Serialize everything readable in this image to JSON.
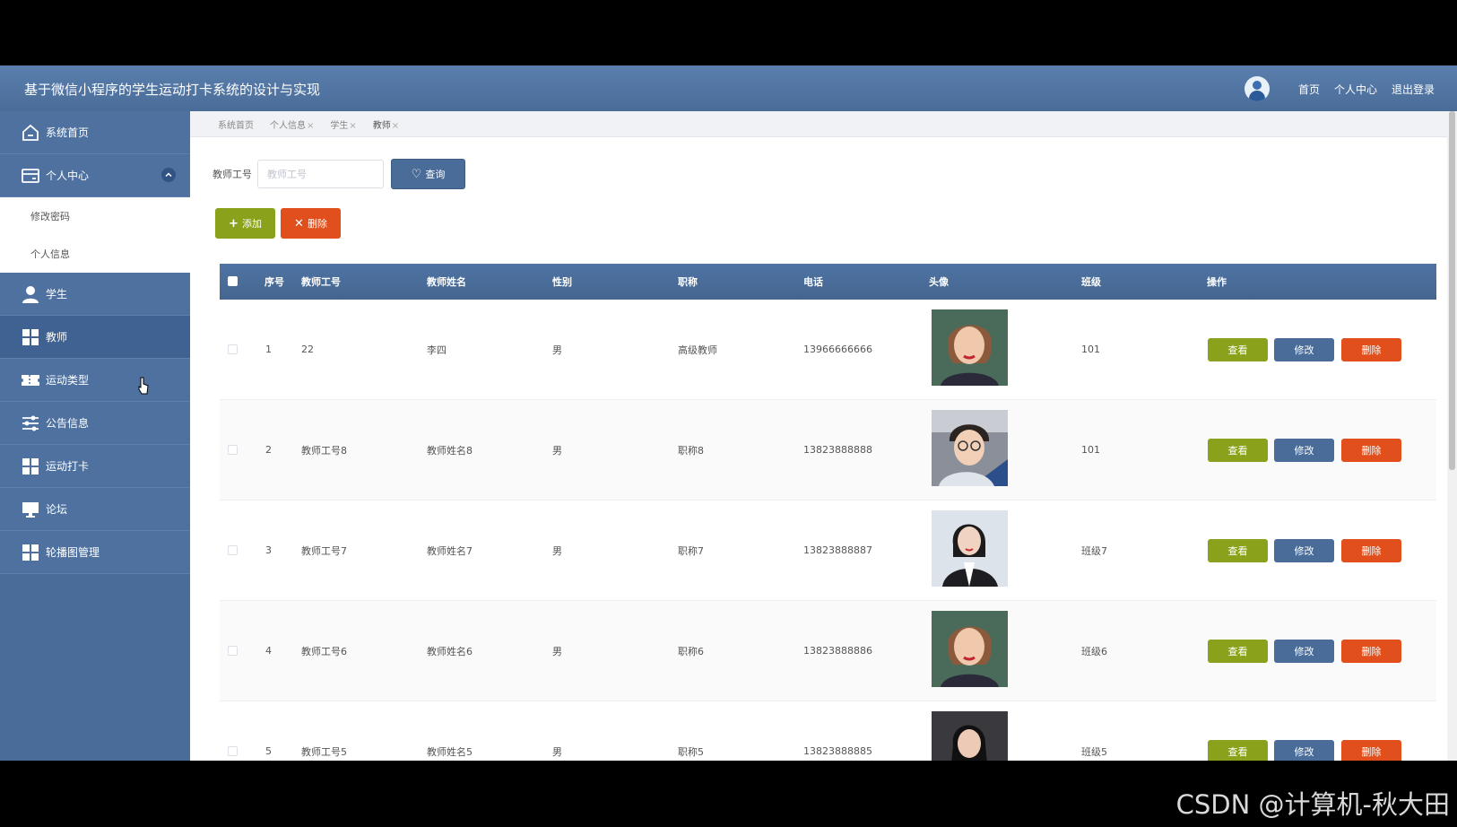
{
  "header": {
    "title": "基于微信小程序的学生运动打卡系统的设计与实现",
    "links": [
      "首页",
      "个人中心",
      "退出登录"
    ]
  },
  "sidebar": {
    "items": [
      {
        "label": "系统首页",
        "icon": "home-icon"
      },
      {
        "label": "个人中心",
        "icon": "card-icon"
      },
      {
        "label": "学生",
        "icon": "user-icon"
      },
      {
        "label": "教师",
        "icon": "grid-icon"
      },
      {
        "label": "运动类型",
        "icon": "ticket-icon"
      },
      {
        "label": "公告信息",
        "icon": "sliders-icon"
      },
      {
        "label": "运动打卡",
        "icon": "grid-icon"
      },
      {
        "label": "论坛",
        "icon": "monitor-icon"
      },
      {
        "label": "轮播图管理",
        "icon": "grid-icon"
      }
    ],
    "submenu": [
      "修改密码",
      "个人信息"
    ]
  },
  "tabs": [
    {
      "label": "系统首页"
    },
    {
      "label": "个人信息",
      "closable": true
    },
    {
      "label": "学生",
      "closable": true
    },
    {
      "label": "教师",
      "closable": true
    }
  ],
  "search": {
    "label": "教师工号",
    "placeholder": "教师工号",
    "query_label": "查询"
  },
  "actions": {
    "add_label": "添加",
    "delete_label": "删除"
  },
  "table": {
    "columns": [
      "序号",
      "教师工号",
      "教师姓名",
      "性别",
      "职称",
      "电话",
      "头像",
      "班级",
      "操作"
    ],
    "rows": [
      {
        "no": "1",
        "id": "22",
        "name": "李四",
        "gender": "男",
        "title": "高级教师",
        "phone": "13966666666",
        "class": "101"
      },
      {
        "no": "2",
        "id": "教师工号8",
        "name": "教师姓名8",
        "gender": "男",
        "title": "职称8",
        "phone": "13823888888",
        "class": "101"
      },
      {
        "no": "3",
        "id": "教师工号7",
        "name": "教师姓名7",
        "gender": "男",
        "title": "职称7",
        "phone": "13823888887",
        "class": "班级7"
      },
      {
        "no": "4",
        "id": "教师工号6",
        "name": "教师姓名6",
        "gender": "男",
        "title": "职称6",
        "phone": "13823888886",
        "class": "班级6"
      },
      {
        "no": "5",
        "id": "教师工号5",
        "name": "教师姓名5",
        "gender": "男",
        "title": "职称5",
        "phone": "13823888885",
        "class": "班级5"
      }
    ],
    "row_actions": {
      "view": "查看",
      "edit": "修改",
      "delete": "删除"
    }
  },
  "watermark": "CSDN @计算机-秋大田",
  "colors": {
    "header": "#4a6c98",
    "add": "#8aa21b",
    "delete": "#e04f1c",
    "edit": "#4a6c98"
  }
}
